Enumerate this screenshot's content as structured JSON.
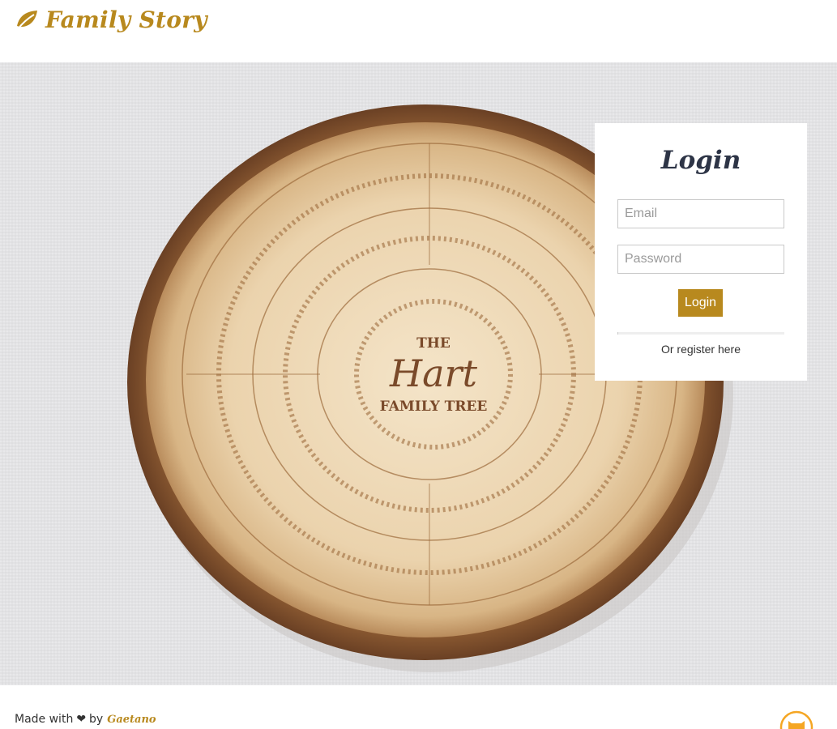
{
  "header": {
    "brand": "Family Story",
    "brand_icon": "leaf-icon"
  },
  "hero": {
    "image": "wooden-family-tree-slice",
    "center_title_top": "THE",
    "center_title_main": "Hart",
    "center_title_bottom": "FAMILY TREE"
  },
  "login": {
    "title": "Login",
    "email_placeholder": "Email",
    "password_placeholder": "Password",
    "button_label": "Login",
    "register_text": "Or register here"
  },
  "footer": {
    "made_with": "Made with",
    "heart": "❤",
    "by": "by",
    "author": "Gaetano",
    "mascot_icon": "cat-icon"
  },
  "colors": {
    "accent": "#b8891e",
    "title_dark": "#2d3446",
    "wood": "#e9d3b0",
    "bark": "#8a5a33"
  }
}
